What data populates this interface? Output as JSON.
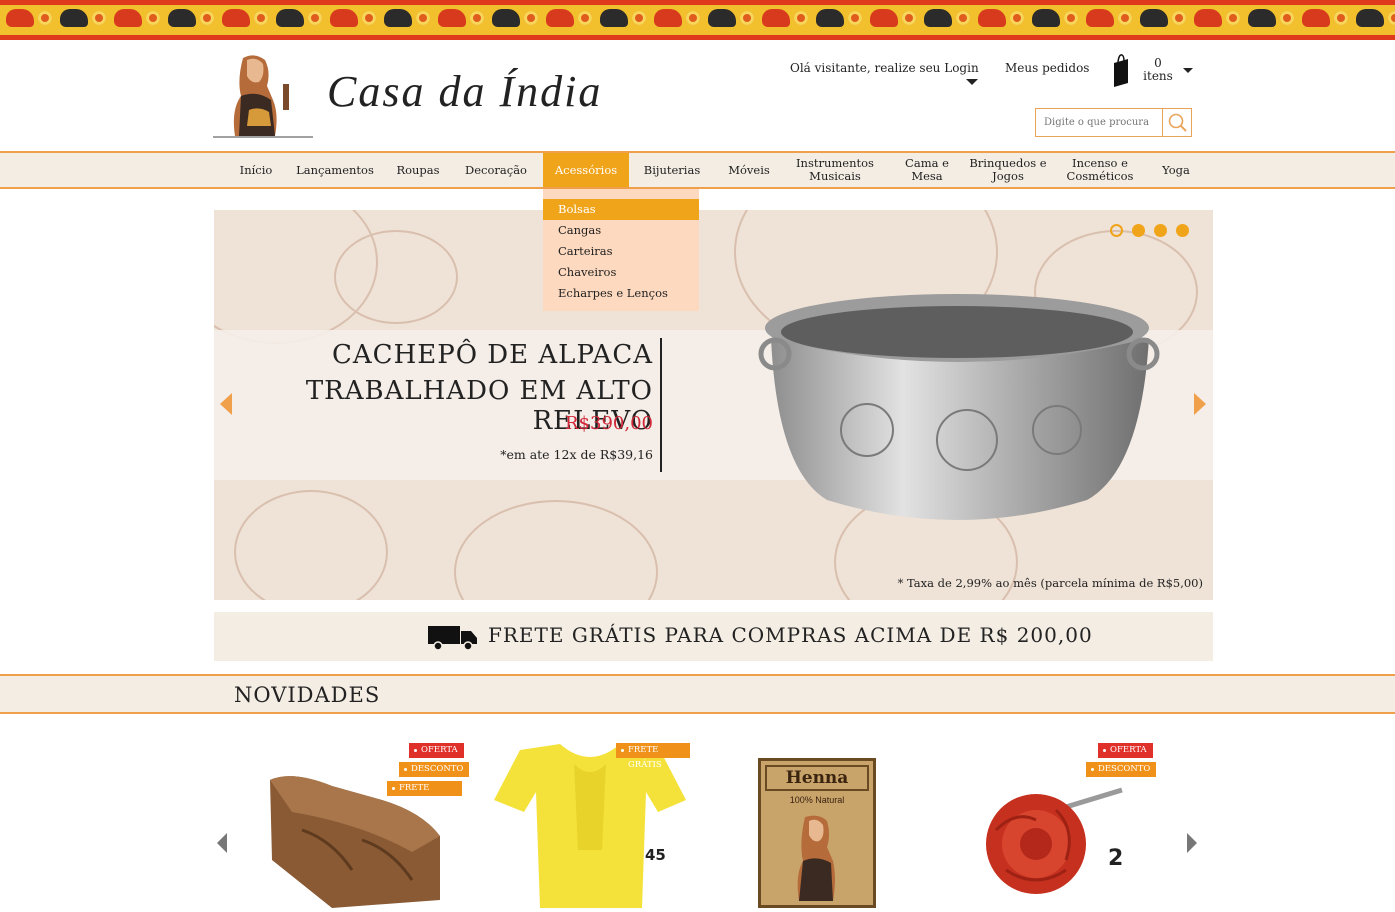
{
  "brand": {
    "name": "Casa da Índia"
  },
  "header": {
    "login_text": "Olá visitante, realize seu Login",
    "orders_text": "Meus pedidos",
    "cart_count": "0",
    "cart_label": "itens",
    "search_placeholder": "Digite o que procura"
  },
  "nav": {
    "items": [
      "Início",
      "Lançamentos",
      "Roupas",
      "Decoração",
      "Acessórios",
      "Bijuterias",
      "Móveis",
      "Instrumentos Musicais",
      "Cama e Mesa",
      "Brinquedos e Jogos",
      "Incenso e Cosméticos",
      "Yoga"
    ],
    "active": "Acessórios"
  },
  "dropdown": {
    "items": [
      "Bolsas",
      "Cangas",
      "Carteiras",
      "Chaveiros",
      "Echarpes e Lenços"
    ],
    "selected": "Bolsas"
  },
  "banner": {
    "title_line1": "CACHEPÔ DE ALPACA",
    "title_line2": "TRABALHADO EM ALTO RELEVO",
    "price": "R$390,00",
    "installments": "*em ate 12x de R$39,16",
    "tax_note": "* Taxa de 2,99% ao mês (parcela mínima de R$5,00)",
    "slides": 4
  },
  "shipping": {
    "text": "FRETE GRÁTIS PARA COMPRAS ACIMA DE R$ 200,00"
  },
  "news": {
    "title": "NOVIDADES",
    "products": [
      {
        "tags": [
          "OFERTA",
          "DESCONTO",
          "FRETE GRÁTIS"
        ],
        "number": ""
      },
      {
        "tags": [
          "FRETE GRÁTIS"
        ],
        "number": "45"
      },
      {
        "tags": [],
        "number": "",
        "package_text": "Henna",
        "package_sub": "100% Natural"
      },
      {
        "tags": [
          "OFERTA",
          "DESCONTO"
        ],
        "number": "2"
      }
    ]
  },
  "colors": {
    "accent": "#f0a41a",
    "price": "#d1283a",
    "band_red": "#e03a1c"
  }
}
